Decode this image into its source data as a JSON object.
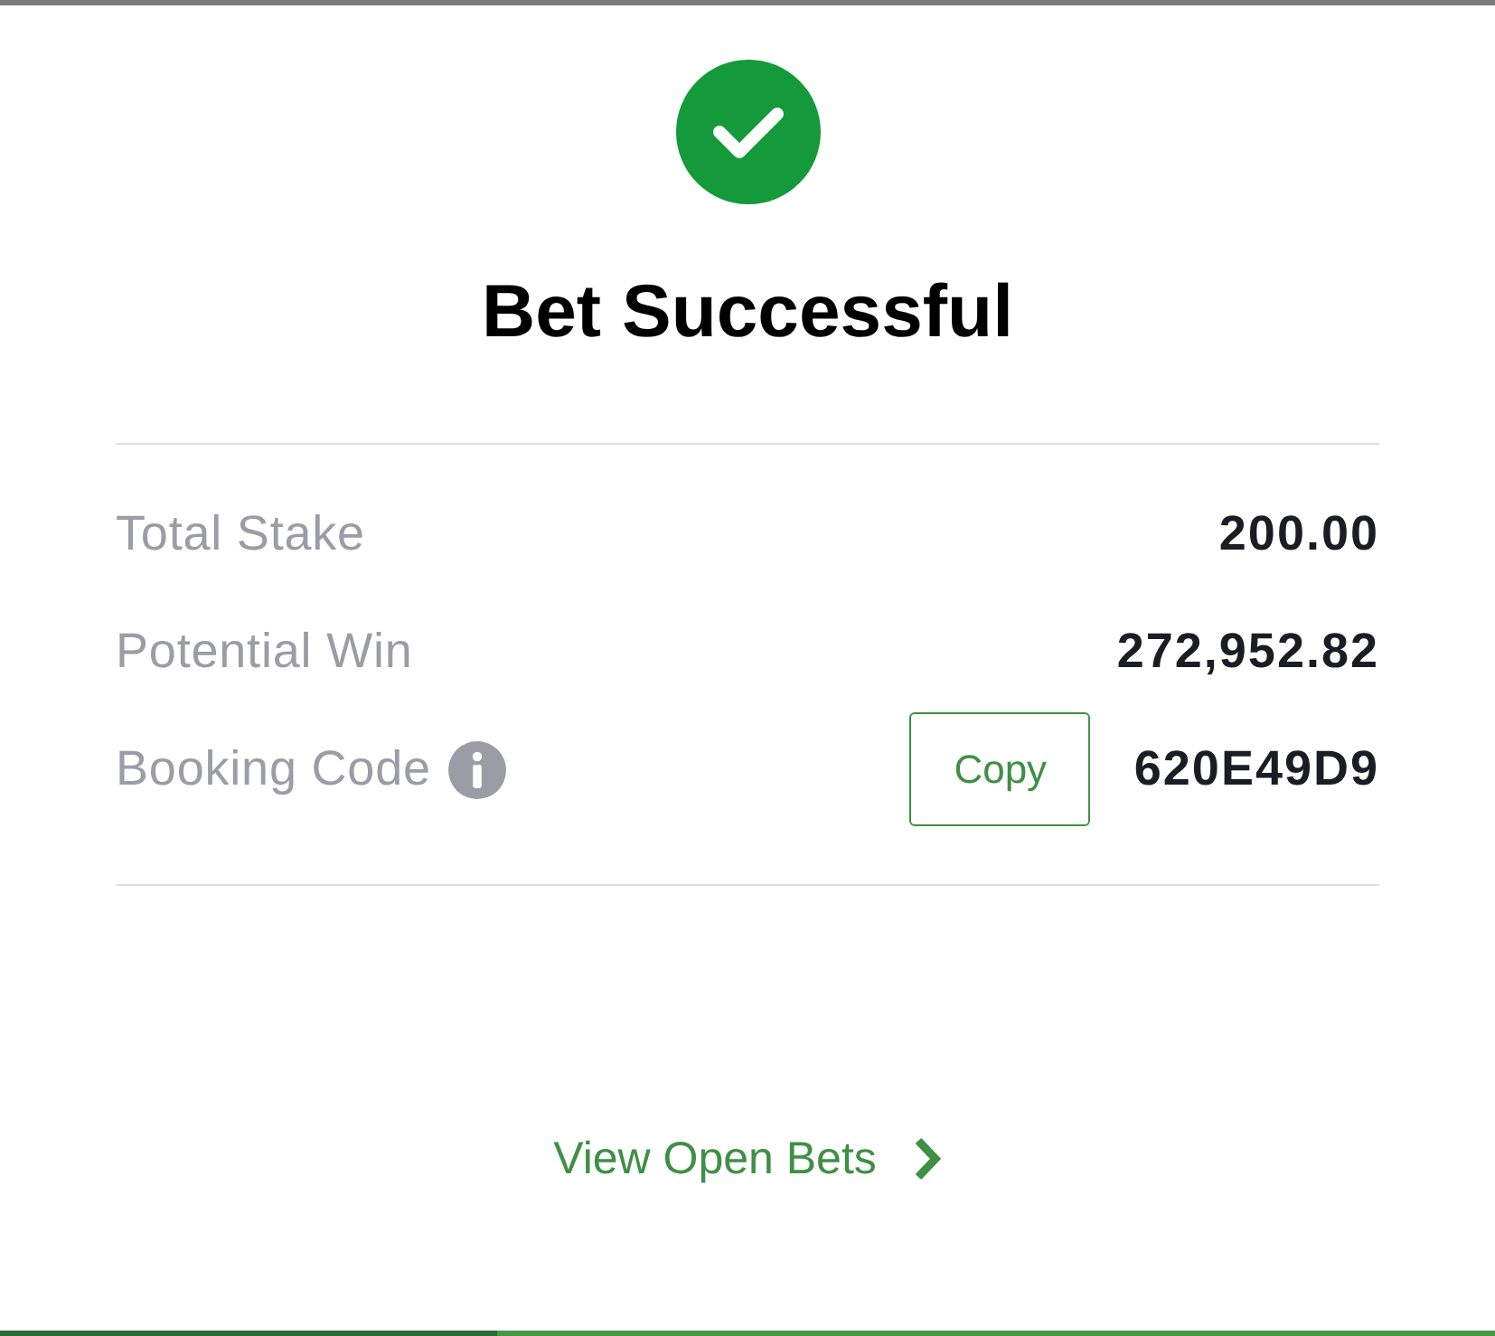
{
  "title": "Bet Successful",
  "details": [
    {
      "label": "Total Stake",
      "value": "200.00",
      "info": false
    },
    {
      "label": "Potential Win",
      "value": "272,952.82",
      "info": false
    },
    {
      "label": "Booking Code",
      "value": "620E49D9",
      "info": true,
      "action": "Copy"
    }
  ],
  "link": {
    "label": "View Open Bets"
  }
}
